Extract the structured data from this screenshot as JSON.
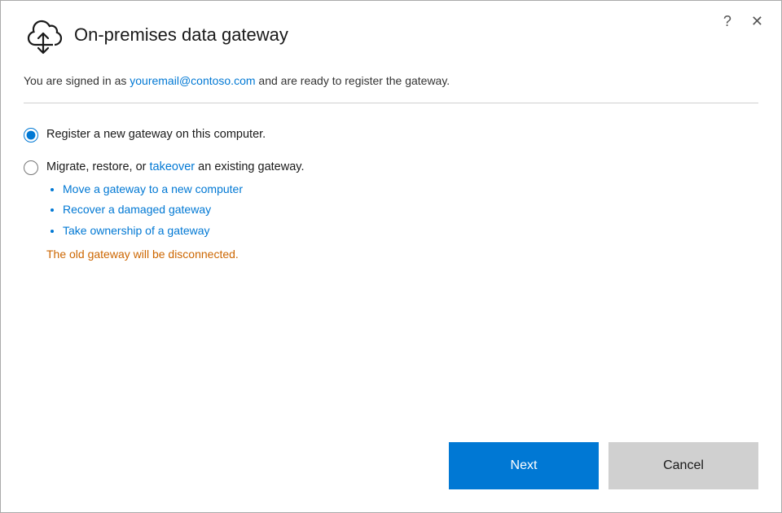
{
  "window": {
    "title": "On-premises data gateway",
    "help_label": "?",
    "close_label": "✕"
  },
  "subtitle": {
    "prefix": "You are signed in as ",
    "email": "youremail@contoso.com",
    "suffix": " and are ready to register the gateway."
  },
  "options": {
    "register_label": "Register a new gateway on this computer.",
    "migrate_label_pre": "Migrate, restore, or ",
    "migrate_takeover": "takeover",
    "migrate_label_post": " an existing gateway.",
    "sub_items": [
      "Move a gateway to a new computer",
      "Recover a damaged gateway",
      "Take ownership of a gateway"
    ],
    "warning": "The old gateway will be disconnected."
  },
  "footer": {
    "next_label": "Next",
    "cancel_label": "Cancel"
  }
}
